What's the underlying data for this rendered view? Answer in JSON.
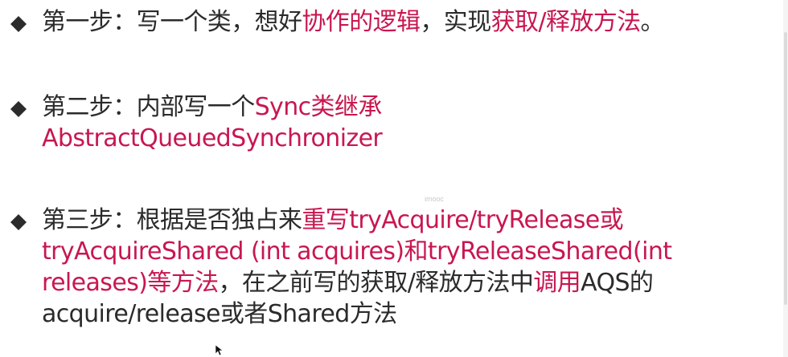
{
  "bullets": [
    {
      "parts": [
        {
          "text": "第一步：写一个类，想好",
          "highlight": false
        },
        {
          "text": "协作的逻辑",
          "highlight": true
        },
        {
          "text": "，实现",
          "highlight": false
        },
        {
          "text": "获取/释放方法",
          "highlight": true
        },
        {
          "text": "。",
          "highlight": false
        }
      ]
    },
    {
      "parts": [
        {
          "text": "第二步：内部写一个",
          "highlight": false
        },
        {
          "text": "Sync类继承 AbstractQueuedSynchronizer",
          "highlight": true
        }
      ]
    },
    {
      "parts": [
        {
          "text": "第三步：根据是否独占来",
          "highlight": false
        },
        {
          "text": "重写tryAcquire/tryRelease或tryAcquireShared (int acquires)和tryReleaseShared(int releases)等方法",
          "highlight": true
        },
        {
          "text": "，在之前写的获取/释放方法中",
          "highlight": false
        },
        {
          "text": "调用",
          "highlight": true
        },
        {
          "text": "AQS的acquire/release或者Shared方法",
          "highlight": false
        }
      ]
    }
  ],
  "watermark": "imooc",
  "colors": {
    "text": "#2b2b2b",
    "highlight": "#c8174f",
    "bullet_marker": "#2b2b2b"
  },
  "icons": {
    "bullet": "diamond-bullet-icon",
    "cursor": "mouse-pointer-icon"
  }
}
